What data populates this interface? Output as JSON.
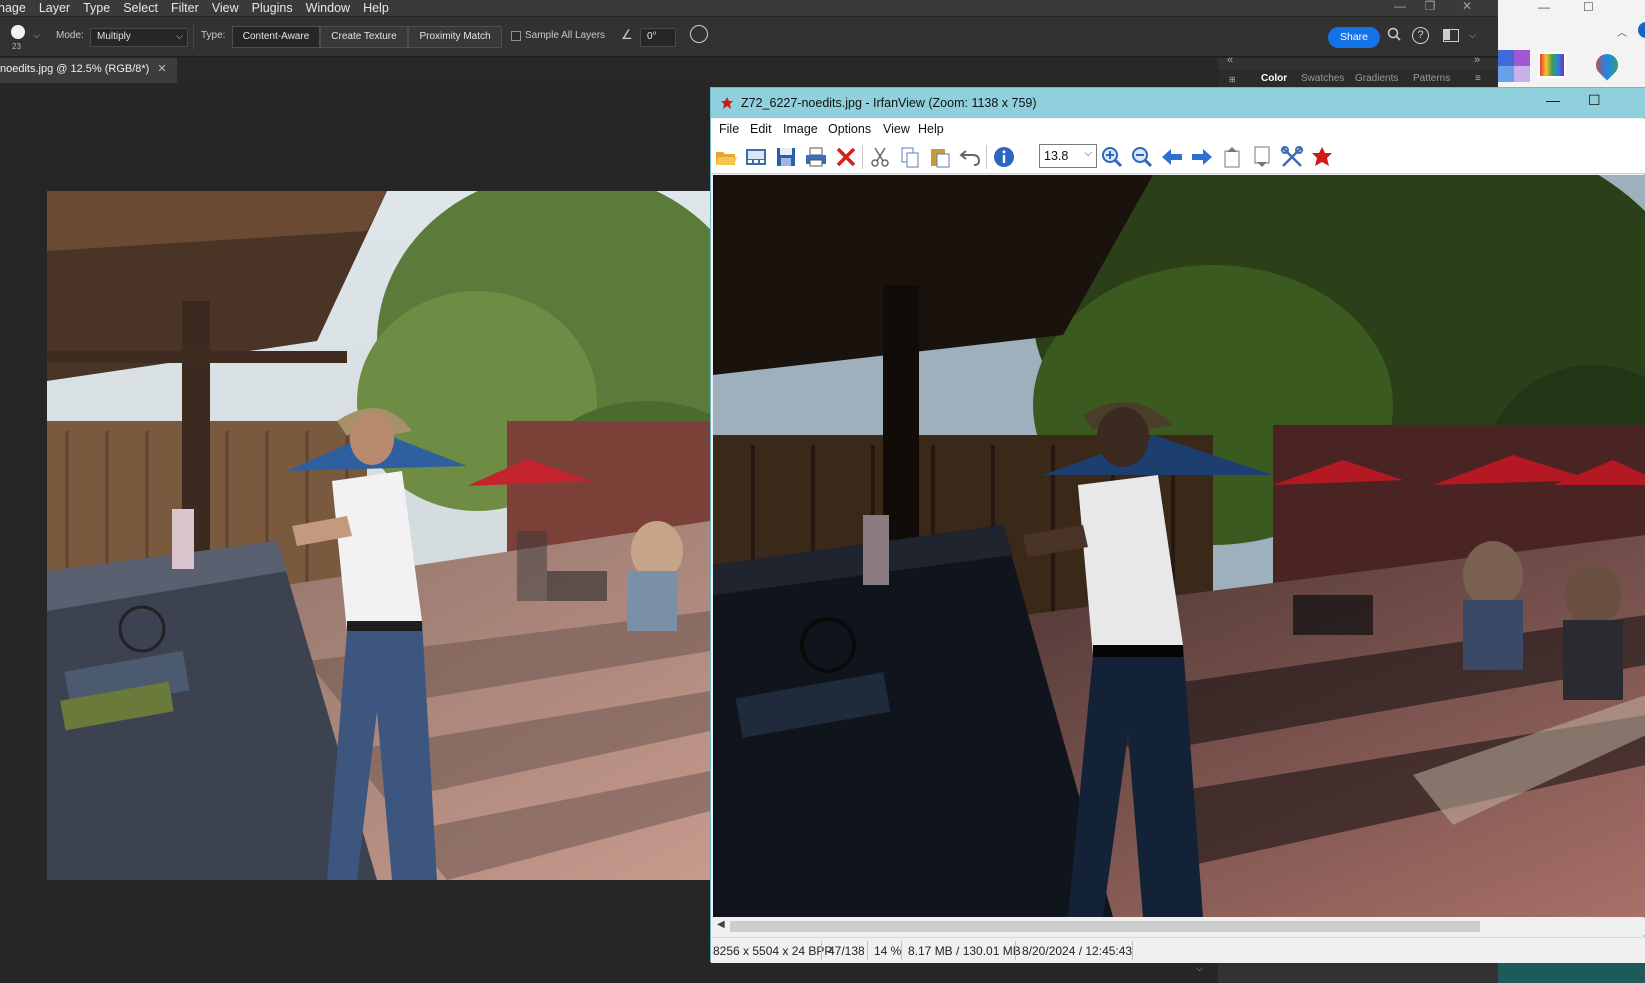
{
  "photoshop": {
    "menu": [
      "nage",
      "Layer",
      "Type",
      "Select",
      "Filter",
      "View",
      "Plugins",
      "Window",
      "Help"
    ],
    "options": {
      "brush_size": "23",
      "mode_label": "Mode:",
      "mode_value": "Multiply",
      "type_label": "Type:",
      "type_buttons": [
        "Content-Aware",
        "Create Texture",
        "Proximity Match"
      ],
      "sample_all_layers": "Sample All Layers",
      "angle_value": "0°",
      "share_label": "Share"
    },
    "document_tab": "noedits.jpg @ 12.5% (RGB/8*)",
    "panel_tabs": [
      "Color",
      "Swatches",
      "Gradients",
      "Patterns"
    ]
  },
  "irfanview": {
    "title": "Z72_6227-noedits.jpg - IrfanView (Zoom: 1138 x 759)",
    "menu": [
      "File",
      "Edit",
      "Image",
      "Options",
      "View",
      "Help"
    ],
    "zoom_value": "13.8",
    "status": {
      "dimensions": "8256 x 5504 x 24 BPP",
      "index": "47/138",
      "zoom": "14 %",
      "size": "8.17 MB / 130.01 MB",
      "datetime": "8/20/2024 / 12:45:43"
    },
    "toolbar_icons": [
      "open-folder-icon",
      "thumbnails-icon",
      "save-icon",
      "print-icon",
      "delete-icon",
      "cut-icon",
      "copy-icon",
      "paste-icon",
      "undo-icon",
      "info-icon",
      "zoom-in-icon",
      "zoom-out-icon",
      "previous-icon",
      "next-icon",
      "first-page-icon",
      "last-page-icon",
      "settings-icon",
      "irfanview-about-icon"
    ]
  },
  "colors": {
    "ps_bg": "#262626",
    "ps_bar": "#323232",
    "share_blue": "#1473e6",
    "iv_title": "#8fd0dc"
  }
}
